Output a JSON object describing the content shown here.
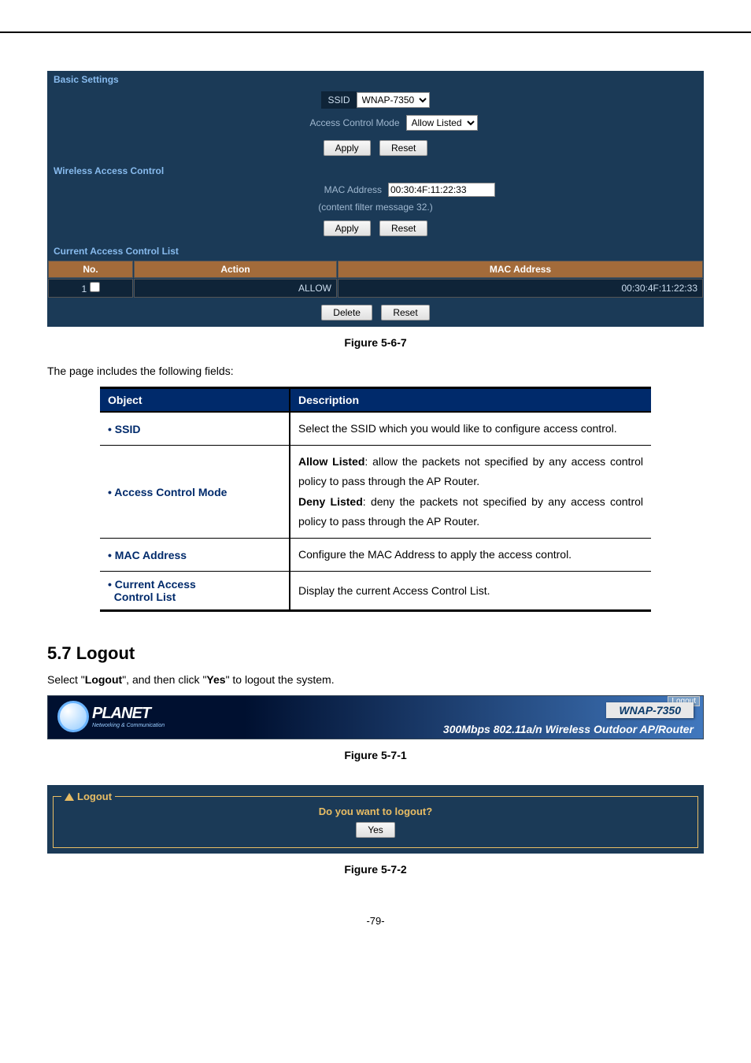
{
  "basic": {
    "header": "Basic Settings",
    "ssid_label": "SSID",
    "ssid_value": "WNAP-7350",
    "acm_label": "Access Control Mode",
    "acm_value": "Allow Listed",
    "apply": "Apply",
    "reset": "Reset"
  },
  "wac": {
    "header": "Wireless Access Control",
    "mac_label": "MAC Address",
    "mac_value": "00:30:4F:11:22:33",
    "hint": "(content filter message 32.)",
    "apply": "Apply",
    "reset": "Reset"
  },
  "list": {
    "header": "Current Access Control List",
    "col_no": "No.",
    "col_action": "Action",
    "col_mac": "MAC Address",
    "row_no": "1",
    "row_action": "ALLOW",
    "row_mac": "00:30:4F:11:22:33",
    "delete": "Delete",
    "reset": "Reset"
  },
  "fig1": "Figure 5-6-7",
  "intro": "The page includes the following fields:",
  "table": {
    "h_object": "Object",
    "h_desc": "Description",
    "r1_obj": "SSID",
    "r1_desc": "Select the SSID which you would like to configure access control.",
    "r2_obj": "Access Control Mode",
    "r2_desc_a": "Allow Listed",
    "r2_desc_b": ": allow the packets not specified by any access control policy to pass through the AP Router.",
    "r2_desc_c": "Deny Listed",
    "r2_desc_d": ": deny the packets not specified by any access control policy to pass through the AP Router.",
    "r3_obj": "MAC Address",
    "r3_desc": "Configure the MAC Address to apply the access control.",
    "r4_obj_a": "Current Access",
    "r4_obj_b": "Control List",
    "r4_desc": "Display the current Access Control List."
  },
  "section": "5.7  Logout",
  "section_text_a": "Select \"",
  "section_text_b": "Logout",
  "section_text_c": "\", and then click \"",
  "section_text_d": "Yes",
  "section_text_e": "\" to logout the system.",
  "banner": {
    "logo": "PLANET",
    "logo_sub": "Networking & Communication",
    "model": "WNAP-7350",
    "tagline": "300Mbps 802.11a/n Wireless Outdoor AP/Router",
    "logout": "Logout"
  },
  "fig2": "Figure 5-7-1",
  "logout_panel": {
    "legend": "Logout",
    "question": "Do you want to logout?",
    "yes": "Yes"
  },
  "fig3": "Figure 5-7-2",
  "page_no": "-79-"
}
